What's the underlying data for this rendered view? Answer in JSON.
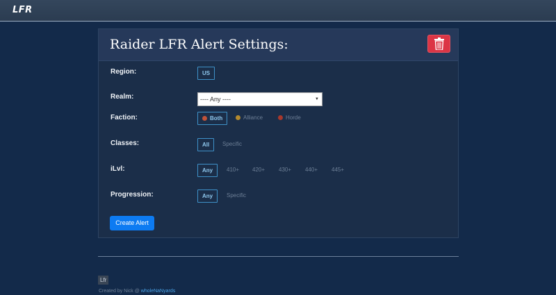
{
  "brand": "LFR",
  "panel": {
    "title": "Raider LFR Alert Settings:",
    "delete_icon": "trash-icon"
  },
  "region": {
    "label": "Region:",
    "options": [
      "US"
    ],
    "selected": "US"
  },
  "realm": {
    "label": "Realm:",
    "selected": "---- Any ----"
  },
  "faction": {
    "label": "Faction:",
    "options": [
      "Both",
      "Alliance",
      "Horde"
    ],
    "selected": "Both"
  },
  "classes": {
    "label": "Classes:",
    "options": [
      "All",
      "Specific"
    ],
    "selected": "All"
  },
  "ilvl": {
    "label": "iLvl:",
    "options": [
      "Any",
      "410+",
      "420+",
      "430+",
      "440+",
      "445+"
    ],
    "selected": "Any"
  },
  "progression": {
    "label": "Progression:",
    "options": [
      "Any",
      "Specific"
    ],
    "selected": "Any"
  },
  "create_button": "Create Alert",
  "footer": {
    "badge": "Lfr",
    "credit_prefix": "Created by Nick @ ",
    "credit_link": "wholeNaNyards"
  },
  "colors": {
    "accent": "#3f92c9",
    "primary": "#0d7bf2",
    "danger": "#dc3545"
  }
}
